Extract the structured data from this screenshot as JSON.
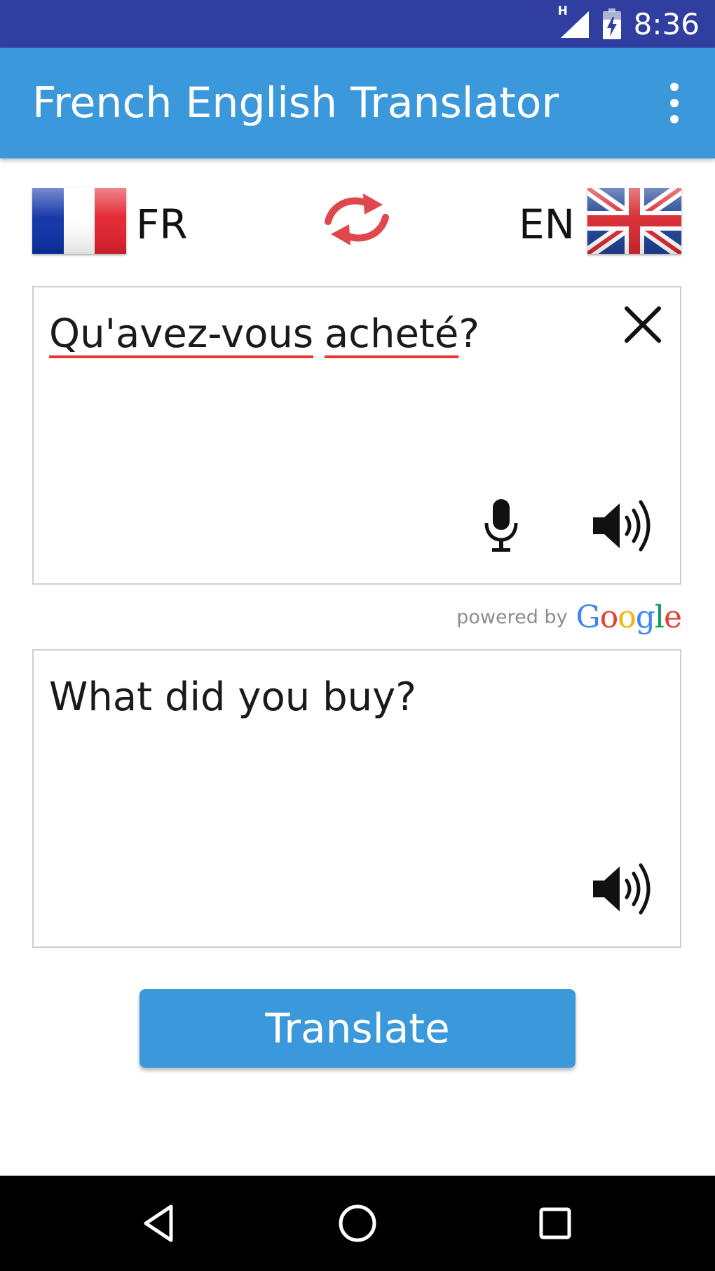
{
  "status_bar": {
    "time": "8:36",
    "network_label": "H",
    "icons": [
      "signal-icon",
      "battery-charging-icon"
    ]
  },
  "app_bar": {
    "title": "French English Translator",
    "overflow_icon": "more-vert-icon"
  },
  "languages": {
    "source_code": "FR",
    "source_flag": "flag-france-icon",
    "target_code": "EN",
    "target_flag": "flag-uk-icon",
    "swap_icon": "swap-arrows-icon"
  },
  "source": {
    "word_1": "Qu'avez-vous",
    "word_2": "acheté",
    "trailing": "?",
    "clear_icon": "close-icon",
    "mic_icon": "microphone-icon",
    "speak_icon": "speaker-icon"
  },
  "attribution": {
    "prefix": "powered by",
    "brand_letters": [
      "G",
      "o",
      "o",
      "g",
      "l",
      "e"
    ]
  },
  "target": {
    "text": "What did you buy?",
    "speak_icon": "speaker-icon"
  },
  "translate_button": {
    "label": "Translate"
  },
  "nav_bar": {
    "icons": [
      "back-icon",
      "home-icon",
      "recents-icon"
    ]
  },
  "colors": {
    "status_bar": "#303f9f",
    "app_bar": "#3a98db",
    "accent": "#3a98db",
    "swap_arrows": "#e0474c",
    "misspell_underline": "#e53935",
    "google_blue": "#4285f4",
    "google_red": "#db4437",
    "google_yellow": "#f4b400",
    "google_green": "#0f9d58"
  }
}
